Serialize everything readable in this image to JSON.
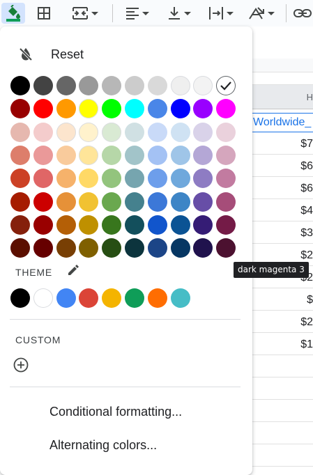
{
  "toolbar": {
    "items": [
      {
        "icon": "fill-color-icon",
        "active": true,
        "dropdown": false
      },
      {
        "icon": "borders-icon",
        "active": false,
        "dropdown": false
      },
      {
        "icon": "merge-cells-icon",
        "active": false,
        "dropdown": true
      },
      {
        "icon": "horizontal-align-icon",
        "active": false,
        "dropdown": true
      },
      {
        "icon": "vertical-align-icon",
        "active": false,
        "dropdown": true
      },
      {
        "icon": "text-wrapping-icon",
        "active": false,
        "dropdown": true
      },
      {
        "icon": "text-rotation-icon",
        "active": false,
        "dropdown": true
      },
      {
        "icon": "insert-link-icon",
        "active": false,
        "dropdown": false
      }
    ]
  },
  "sheet": {
    "column_letter": "H",
    "header_cell": "Worldwide_",
    "values": [
      "$7",
      "$6",
      "$6",
      "$4",
      "$3",
      "$2",
      "$2",
      "$",
      "$2",
      "$1"
    ]
  },
  "palette": {
    "reset_label": "Reset",
    "standard_rows": [
      [
        "#000000",
        "#434343",
        "#666666",
        "#999999",
        "#b7b7b7",
        "#cccccc",
        "#d9d9d9",
        "#efefef",
        "#f3f3f3",
        "#ffffff"
      ],
      [
        "#980000",
        "#ff0000",
        "#ff9900",
        "#ffff00",
        "#00ff00",
        "#00ffff",
        "#4a86e8",
        "#0000ff",
        "#9900ff",
        "#ff00ff"
      ],
      [
        "#e6b8af",
        "#f4cccc",
        "#fce5cd",
        "#fff2cc",
        "#d9ead3",
        "#d0e0e3",
        "#c9daf8",
        "#cfe2f3",
        "#d9d2e9",
        "#ead1dc"
      ],
      [
        "#dd7e6b",
        "#ea9999",
        "#f9cb9c",
        "#ffe599",
        "#b6d7a8",
        "#a2c4c9",
        "#a4c2f4",
        "#9fc5e8",
        "#b4a7d6",
        "#d5a6bd"
      ],
      [
        "#cc4125",
        "#e06666",
        "#f6b26b",
        "#ffd966",
        "#93c47d",
        "#76a5af",
        "#6d9eeb",
        "#6fa8dc",
        "#8e7cc3",
        "#c27ba0"
      ],
      [
        "#a61c00",
        "#cc0000",
        "#e69138",
        "#f1c232",
        "#6aa84f",
        "#45818e",
        "#3c78d8",
        "#3d85c6",
        "#674ea7",
        "#a64d79"
      ],
      [
        "#85200c",
        "#990000",
        "#b45f06",
        "#bf9000",
        "#38761d",
        "#134f5c",
        "#1155cc",
        "#0b5394",
        "#351c75",
        "#741b47"
      ],
      [
        "#5b0f00",
        "#660000",
        "#783f04",
        "#7f6000",
        "#274e13",
        "#0c343d",
        "#1c4587",
        "#073763",
        "#20124d",
        "#4c1130"
      ]
    ],
    "selected_color": "#ffffff",
    "hovered_color": "#4c1130",
    "theme_label": "THEME",
    "theme_colors": [
      "#000000",
      "#ffffff",
      "#4285f4",
      "#db4437",
      "#f4b400",
      "#0f9d58",
      "#ff6d01",
      "#46bdc6"
    ],
    "custom_label": "CUSTOM",
    "items": [
      "Conditional formatting...",
      "Alternating colors..."
    ]
  },
  "tooltip": {
    "text": "dark magenta 3"
  }
}
